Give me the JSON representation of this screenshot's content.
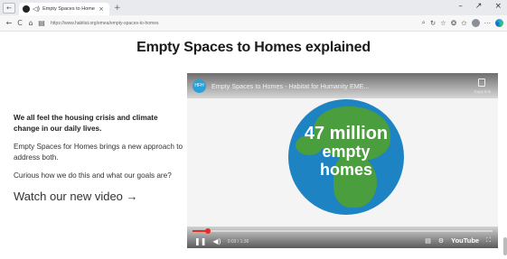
{
  "browser": {
    "tab_title": "Empty Spaces to Homes | ...",
    "url": "https://www.habitat.org/emea/empty-spaces-to-homes",
    "icons": {
      "tab_ctrl": "←",
      "sound": "◁)",
      "close": "×",
      "new_tab": "+",
      "back": "←",
      "refresh": "C",
      "home": "⌂",
      "lock": "▤",
      "minimize": "–",
      "maximize": "↗",
      "window_close": "×",
      "zoom": "⌕",
      "share": "↻",
      "favorite": "☆",
      "extensions": "❂",
      "collections": "✩",
      "more": "⋯"
    }
  },
  "page": {
    "heading": "Empty Spaces to Homes explained",
    "intro": "We all feel the housing crisis and climate change in our daily lives.",
    "para1": "Empty Spaces for Homes brings a new approach to address both.",
    "para2": "Curious how we do this and what our goals are?",
    "watch_link": "Watch our new video →"
  },
  "video": {
    "channel_badge": "HFH",
    "title": "Empty Spaces to Homes - Habitat for Humanity EME...",
    "copy_label": "Copy link",
    "globe_line1": "47 million",
    "globe_line2": "empty",
    "globe_line3": "homes",
    "progress": 0.05,
    "time": "0:03 / 1:36",
    "icons": {
      "play_pause": "❚❚",
      "volume": "◀)",
      "captions": "▤",
      "settings": "⚙",
      "fullscreen": "⛶"
    },
    "youtube_label": "YouTube"
  }
}
